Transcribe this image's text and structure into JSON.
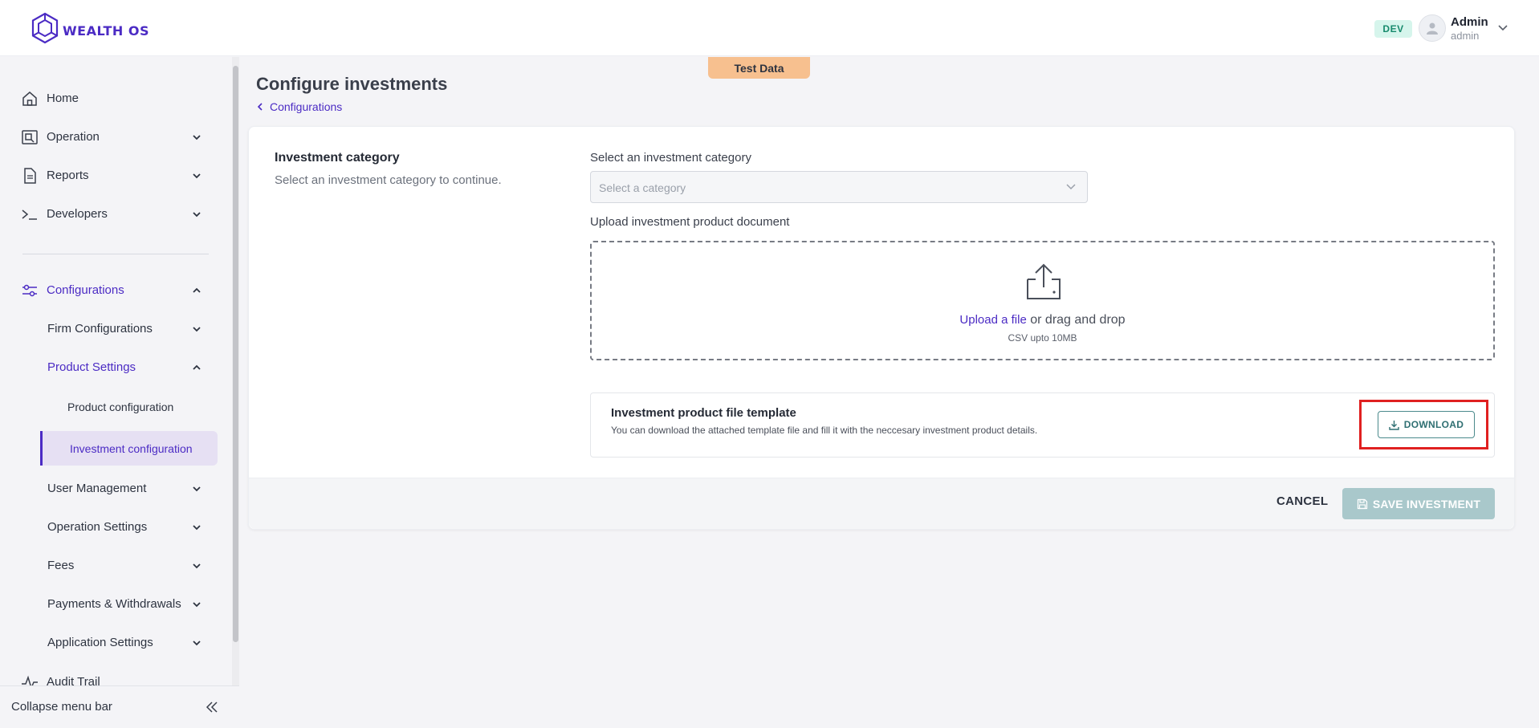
{
  "header": {
    "logo_text": "WEALTH OS",
    "env_badge": "DEV",
    "user_name": "Admin",
    "user_role": "admin"
  },
  "sidebar": {
    "items": [
      {
        "label": "Home"
      },
      {
        "label": "Operation"
      },
      {
        "label": "Reports"
      },
      {
        "label": "Developers"
      },
      {
        "label": "Configurations"
      },
      {
        "label": "Audit Trail"
      }
    ],
    "config_sub": [
      {
        "label": "Firm Configurations"
      },
      {
        "label": "Product Settings"
      },
      {
        "label": "User Management"
      },
      {
        "label": "Operation Settings"
      },
      {
        "label": "Fees"
      },
      {
        "label": "Payments & Withdrawals"
      },
      {
        "label": "Application Settings"
      }
    ],
    "product_sub": [
      {
        "label": "Product configuration"
      },
      {
        "label": "Investment configuration"
      }
    ],
    "collapse_label": "Collapse menu bar"
  },
  "main": {
    "title": "Configure investments",
    "test_data": "Test Data",
    "breadcrumb": "Configurations",
    "section_title": "Investment category",
    "section_sub": "Select an investment category to continue.",
    "select_label": "Select an investment category",
    "select_placeholder": "Select a category",
    "upload_label": "Upload investment product document",
    "upload_link": "Upload a file",
    "upload_rest": " or drag and drop",
    "upload_hint": "CSV upto 10MB",
    "template_title": "Investment product file template",
    "template_desc": "You can download the attached template file and fill it with the neccesary investment product details.",
    "download_label": "DOWNLOAD",
    "cancel_label": "CANCEL",
    "save_label": "SAVE INVESTMENT"
  },
  "colors": {
    "brand": "#4b2bc4",
    "teal": "#2f6f72",
    "highlight": "#e02020",
    "test_badge": "#f7c08f"
  }
}
